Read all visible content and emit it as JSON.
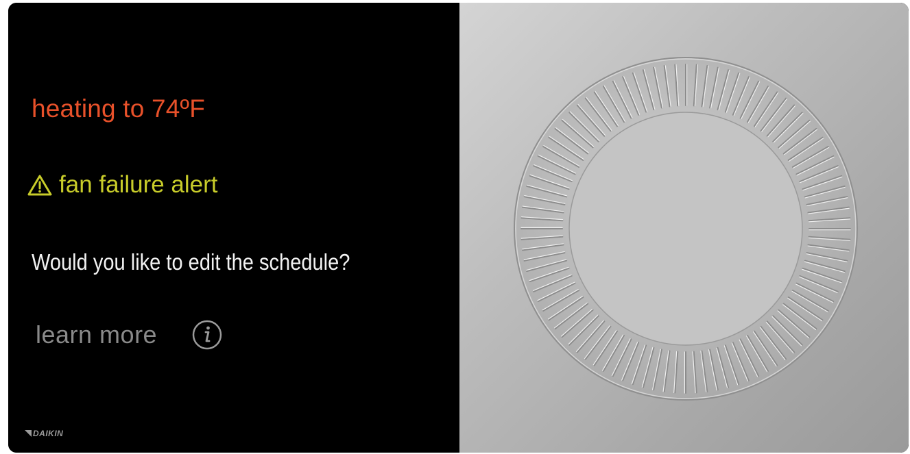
{
  "screen": {
    "status_heating": "heating to 74ºF",
    "alert_text": "fan failure alert",
    "alert_icon": "warning-triangle-icon",
    "question": "Would you like to edit the schedule?",
    "learn_more": "learn more",
    "info_icon": "info-icon",
    "brand": "DAIKIN"
  },
  "colors": {
    "heating": "#e8512a",
    "alert": "#c8cc2a",
    "question": "#f2f2f2",
    "learn_more": "#8a8a8a",
    "screen_bg": "#000000",
    "panel": "#b5b5b5"
  }
}
